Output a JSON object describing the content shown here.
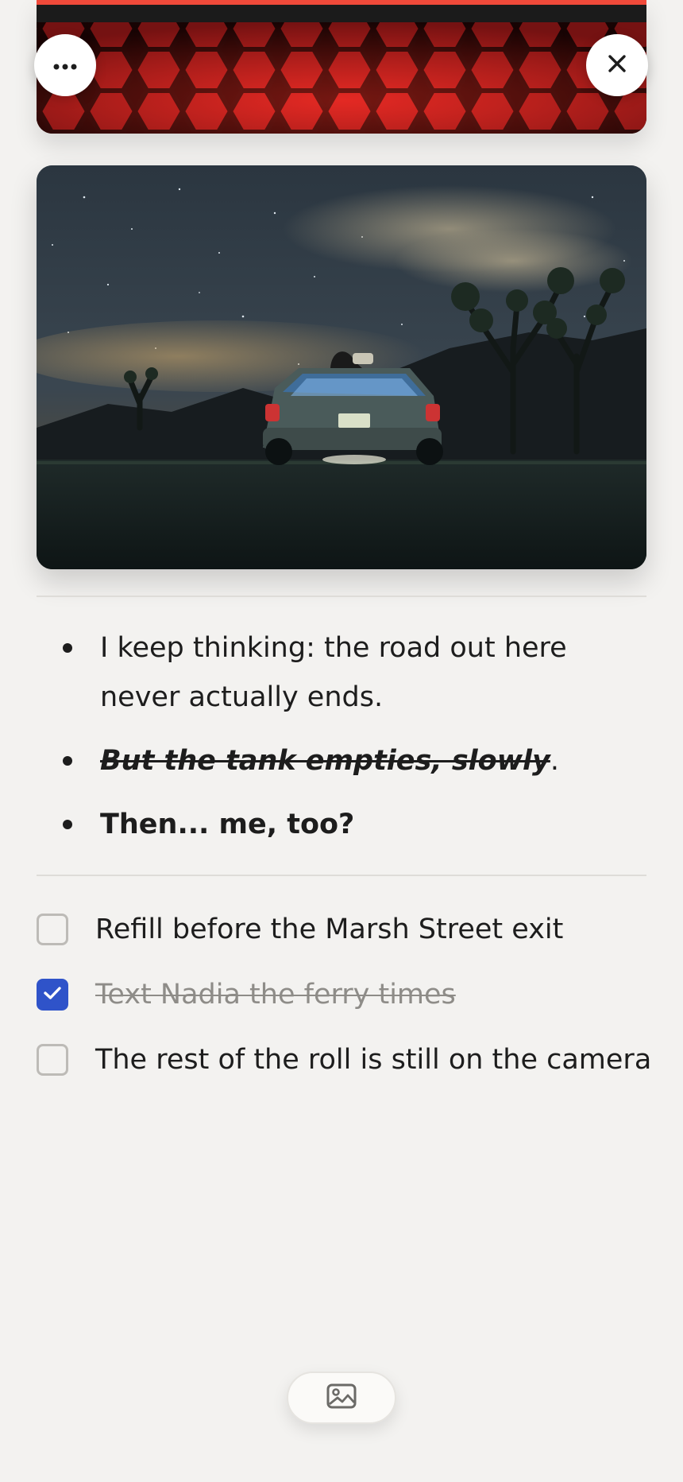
{
  "toolbar": {
    "more_icon": "more-horizontal-icon",
    "close_icon": "close-icon",
    "insert_image_icon": "image-icon"
  },
  "bullets": [
    {
      "text": "I keep thinking: the road out here never actually ends."
    },
    {
      "text": "But the tank empties, slowly",
      "suffix": "."
    },
    {
      "text": "Then... me, too?"
    }
  ],
  "checklist": [
    {
      "text": "Refill before the Marsh Street exit",
      "checked": false
    },
    {
      "text": "Text Nadia the ferry times",
      "checked": true
    },
    {
      "text": "The rest of the roll is still on the camera",
      "checked": false
    }
  ],
  "colors": {
    "background": "#f3f2f0",
    "checkbox_accent": "#2f53c9",
    "text": "#1d1d1d",
    "done_text": "#8e8c88"
  }
}
